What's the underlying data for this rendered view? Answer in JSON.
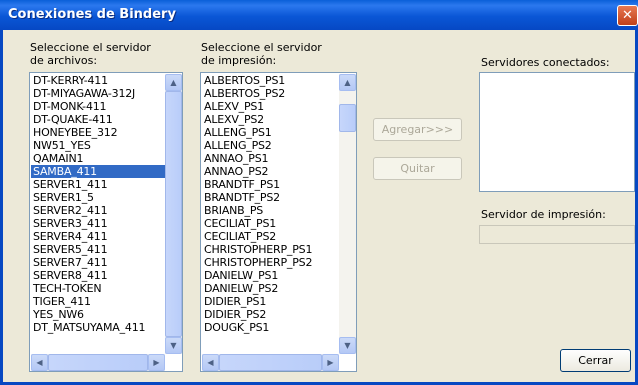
{
  "window": {
    "title": "Conexiones de Bindery",
    "close_glyph": "✕"
  },
  "file_servers": {
    "label_line1": "Seleccione el servidor",
    "label_line2": "de archivos:",
    "items": [
      "DT-KERRY-411",
      "DT-MIYAGAWA-312J",
      "DT-MONK-411",
      "DT-QUAKE-411",
      "HONEYBEE_312",
      "NW51_YES",
      "QAMAIN1",
      "SAMBA_411",
      "SERVER1_411",
      "SERVER1_5",
      "SERVER2_411",
      "SERVER3_411",
      "SERVER4_411",
      "SERVER5_411",
      "SERVER7_411",
      "SERVER8_411",
      "TECH-TOKEN",
      "TIGER_411",
      "YES_NW6",
      "DT_MATSUYAMA_411"
    ],
    "selected_index": 7
  },
  "print_servers": {
    "label_line1": "Seleccione el servidor",
    "label_line2": "de impresión:",
    "items": [
      "ALBERTOS_PS1",
      "ALBERTOS_PS2",
      "ALEXV_PS1",
      "ALEXV_PS2",
      "ALLENG_PS1",
      "ALLENG_PS2",
      "ANNAO_PS1",
      "ANNAO_PS2",
      "BRANDTF_PS1",
      "BRANDTF_PS2",
      "BRIANB_PS",
      "CECILIAT_PS1",
      "CECILIAT_PS2",
      "CHRISTOPHERP_PS1",
      "CHRISTOPHERP_PS2",
      "DANIELW_PS1",
      "DANIELW_PS2",
      "DIDIER_PS1",
      "DIDIER_PS2",
      "DOUGK_PS1"
    ]
  },
  "actions": {
    "add_label": "Agregar>>>",
    "remove_label": "Quitar",
    "close_label": "Cerrar"
  },
  "connected": {
    "label": "Servidores conectados:",
    "print_server_label": "Servidor de impresión:",
    "print_server_value": ""
  },
  "scroll_glyphs": {
    "up": "▲",
    "down": "▼",
    "left": "◀",
    "right": "▶"
  }
}
